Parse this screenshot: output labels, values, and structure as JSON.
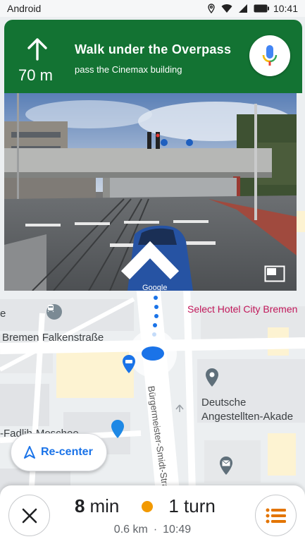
{
  "status_bar": {
    "os_label": "Android",
    "time": "10:41",
    "icons": [
      "location-icon",
      "wifi-icon",
      "signal-icon",
      "battery-icon"
    ]
  },
  "navigation": {
    "maneuver_icon": "straight-arrow-icon",
    "distance": "70 m",
    "instruction": "Walk under the Overpass",
    "subtext": "pass the Cinemax building",
    "voice_button_icon": "mic-icon",
    "banner_color": "#137333"
  },
  "street_view": {
    "watermark": "Google",
    "expand_icon": "expand-icon",
    "chevron_icon": "chevron-up-icon"
  },
  "map": {
    "labels": {
      "hotel": "Select Hotel City Bremen",
      "station": "Bremen Falkenstraße",
      "street": "Bürgermeister-Smidt-Straße",
      "academy_line1": "Deutsche",
      "academy_line2": "Angestellten-Akade",
      "left_fragment": "-Fadlih-Moschee",
      "top_left_fragment": "e"
    },
    "poi_icons": [
      "transit-icon",
      "hotel-icon",
      "landmark-pin-icon",
      "mosque-icon",
      "mail-icon",
      "location-dot-icon"
    ]
  },
  "recenter": {
    "label": "Re-center",
    "icon": "navigation-arrow-icon",
    "accent": "#1a73e8"
  },
  "trip": {
    "minutes": "8",
    "minutes_unit": "min",
    "turns": "1 turn",
    "distance": "0.6 km",
    "separator": "·",
    "eta": "10:49",
    "dot_color": "#f29900",
    "close_icon": "close-icon",
    "steps_icon": "list-icon"
  }
}
